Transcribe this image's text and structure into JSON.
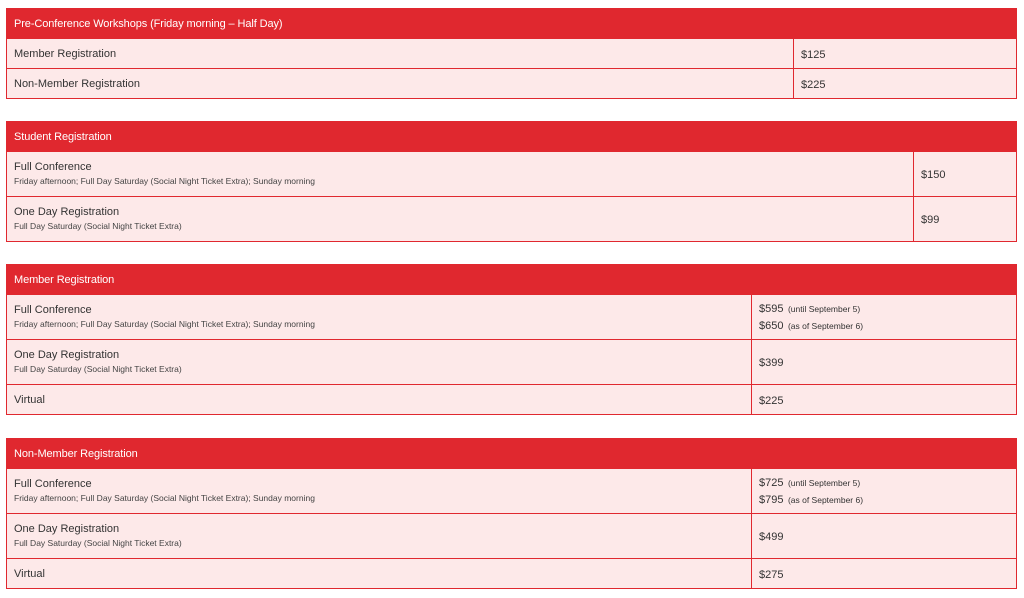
{
  "sections": [
    {
      "title": "Pre-Conference Workshops (Friday morning – Half Day)",
      "rows": [
        {
          "name": "Member Registration",
          "desc": "",
          "price": "$125",
          "note": "",
          "price2": "",
          "note2": ""
        },
        {
          "name": "Non-Member Registration",
          "desc": "",
          "price": "$225",
          "note": "",
          "price2": "",
          "note2": ""
        }
      ]
    },
    {
      "title": "Student Registration",
      "rows": [
        {
          "name": "Full Conference",
          "desc": "Friday afternoon; Full Day Saturday (Social Night Ticket Extra); Sunday morning",
          "price": "$150",
          "note": "",
          "price2": "",
          "note2": ""
        },
        {
          "name": "One Day Registration",
          "desc": "Full Day Saturday (Social Night Ticket Extra)",
          "price": "$99",
          "note": "",
          "price2": "",
          "note2": ""
        }
      ]
    },
    {
      "title": "Member Registration",
      "rows": [
        {
          "name": "Full Conference",
          "desc": "Friday afternoon; Full Day Saturday (Social Night Ticket Extra); Sunday morning",
          "price": "$595",
          "note": "(until September 5)",
          "price2": "$650",
          "note2": "(as of September 6)"
        },
        {
          "name": "One Day Registration",
          "desc": "Full Day Saturday (Social Night Ticket Extra)",
          "price": "$399",
          "note": "",
          "price2": "",
          "note2": ""
        },
        {
          "name": "Virtual",
          "desc": "",
          "price": "$225",
          "note": "",
          "price2": "",
          "note2": ""
        }
      ]
    },
    {
      "title": "Non-Member Registration",
      "rows": [
        {
          "name": "Full Conference",
          "desc": "Friday afternoon; Full Day Saturday (Social Night Ticket Extra); Sunday morning",
          "price": "$725",
          "note": "(until September 5)",
          "price2": "$795",
          "note2": "(as of September 6)"
        },
        {
          "name": "One Day Registration",
          "desc": "Full Day Saturday (Social Night Ticket Extra)",
          "price": "$499",
          "note": "",
          "price2": "",
          "note2": ""
        },
        {
          "name": "Virtual",
          "desc": "",
          "price": "$275",
          "note": "",
          "price2": "",
          "note2": ""
        }
      ]
    }
  ],
  "colors": {
    "header_bg": "#e0282f",
    "row_bg": "#fde9e9",
    "border": "#e0282f"
  }
}
